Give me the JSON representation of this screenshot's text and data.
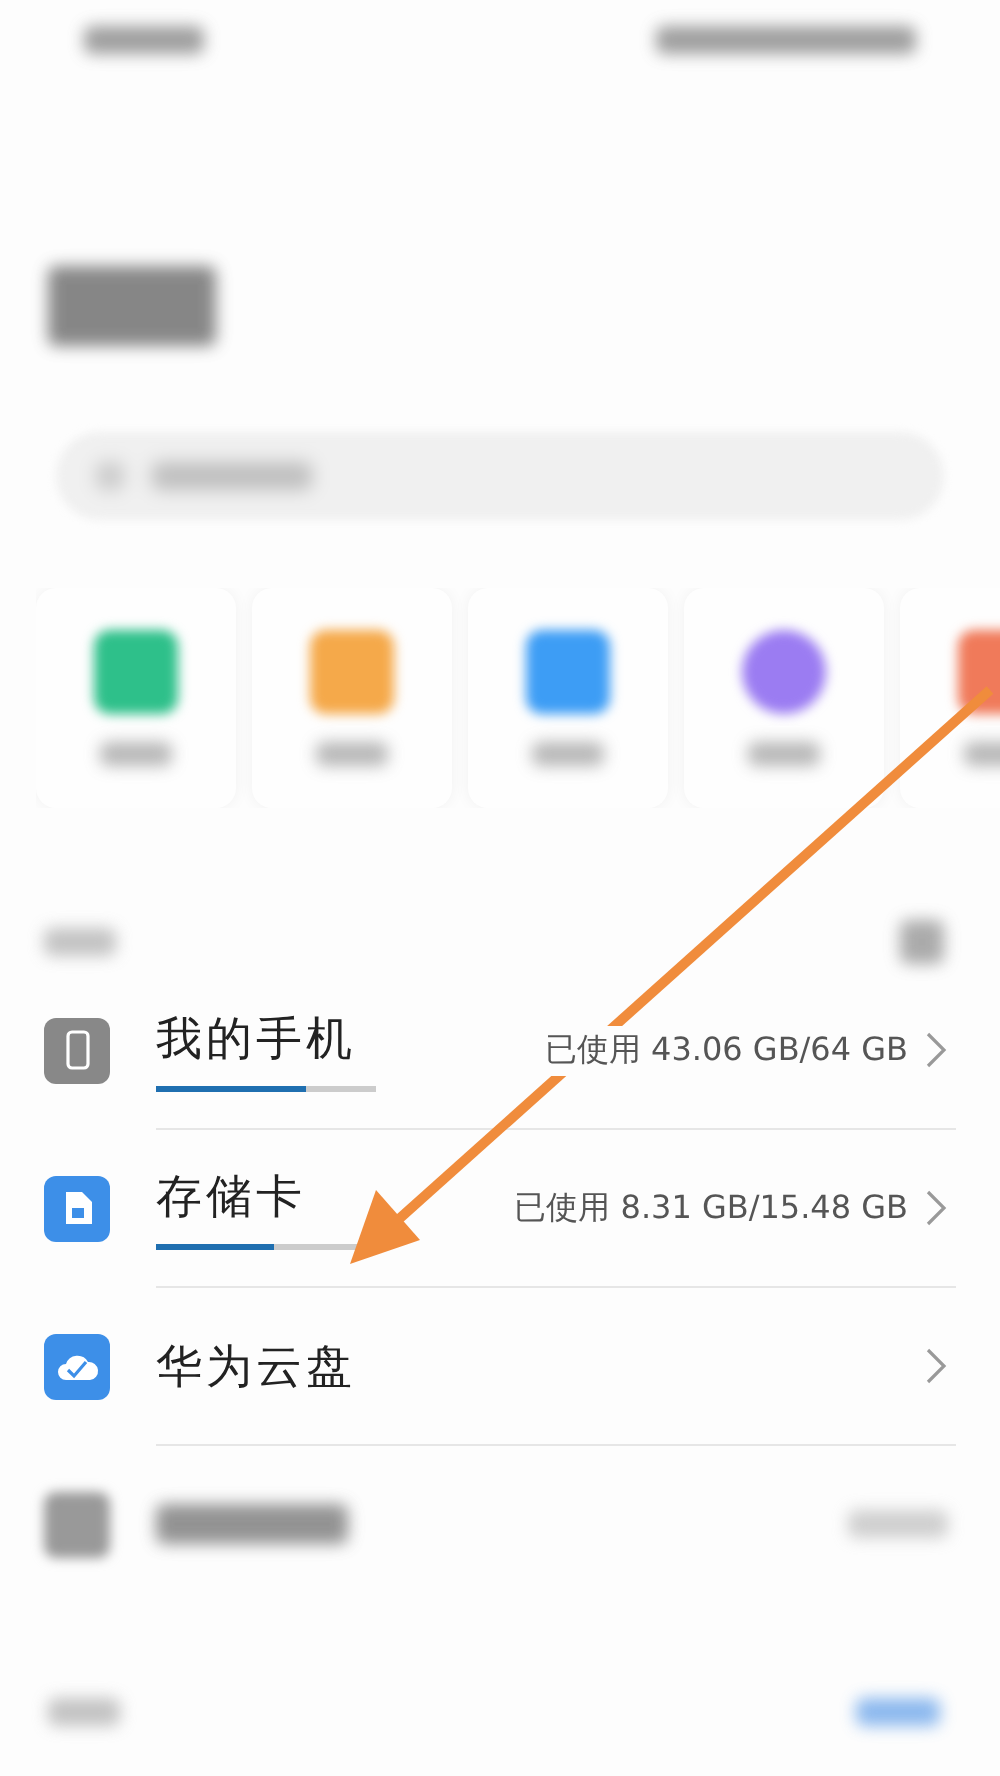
{
  "categories": [
    {
      "color": "#2ec08a",
      "kind": "picture"
    },
    {
      "color": "#f5a94a",
      "kind": "video"
    },
    {
      "color": "#3d9df5",
      "kind": "document"
    },
    {
      "color": "#9b7cf2",
      "kind": "audio"
    },
    {
      "color": "#f07a5a",
      "kind": "other"
    }
  ],
  "locations": [
    {
      "kind": "phone",
      "name": "我的手机",
      "usage": "已使用 43.06 GB/64 GB",
      "level": 0.68
    },
    {
      "kind": "sdcard",
      "name": "存储卡",
      "usage": "已使用 8.31 GB/15.48 GB",
      "level": 0.54
    },
    {
      "kind": "cloud",
      "name": "华为云盘"
    },
    {
      "kind": "blurred"
    }
  ]
}
